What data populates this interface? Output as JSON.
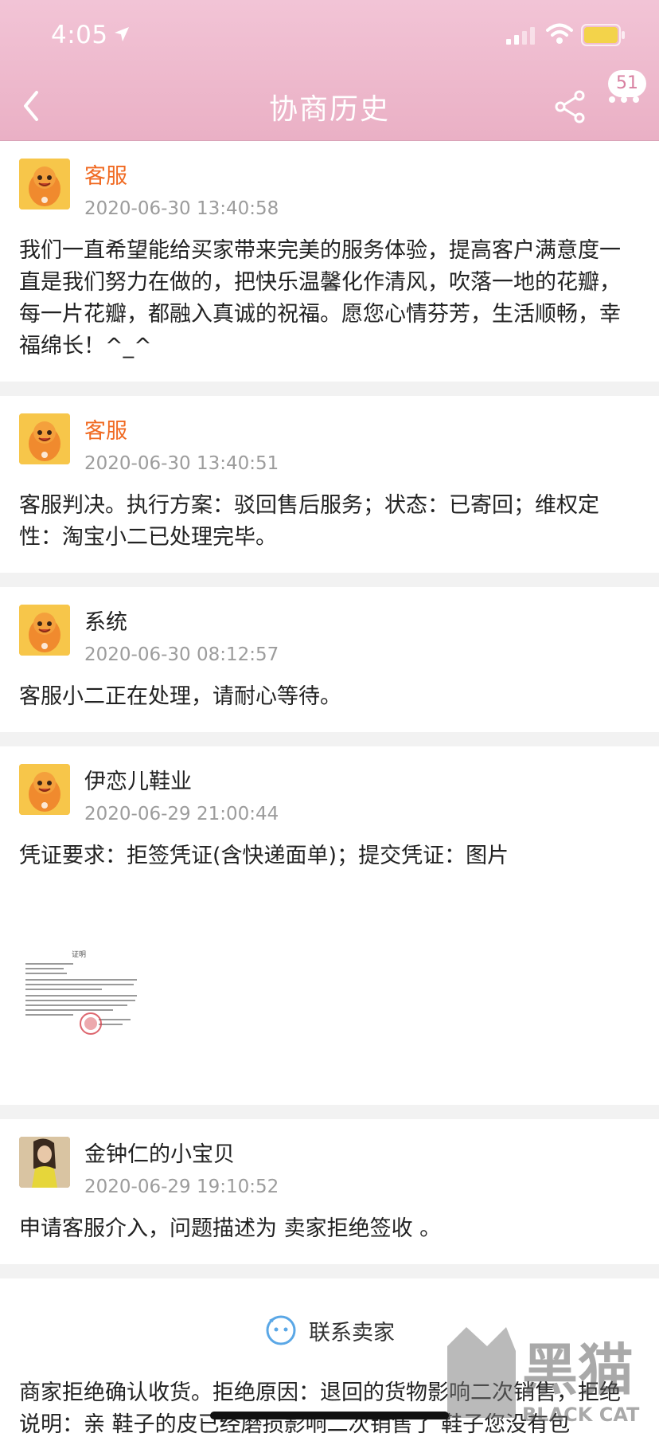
{
  "status_bar": {
    "time": "4:05",
    "icons": [
      "location-arrow-icon",
      "signal-icon",
      "wifi-icon",
      "battery-icon"
    ]
  },
  "nav": {
    "title": "协商历史",
    "badge_count": "51",
    "icons": [
      "back-icon",
      "share-icon",
      "more-icon"
    ]
  },
  "colors": {
    "header_bg": "#eab0c5",
    "customer_service_name": "#f06a22",
    "timestamp": "#9c9c9c",
    "separator": "#f2f2f2"
  },
  "records": [
    {
      "sender": "客服",
      "timestamp": "2020-06-30 13:40:58",
      "text": "我们一直希望能给买家带来完美的服务体验，提高客户满意度一直是我们努力在做的，把快乐温馨化作清风，吹落一地的花瓣，每一片花瓣，都融入真诚的祝福。愿您心情芬芳，生活顺畅，幸福绵长！^_^"
    },
    {
      "sender": "客服",
      "timestamp": "2020-06-30 13:40:51",
      "text": "客服判决。执行方案：驳回售后服务；状态：已寄回；维权定性：淘宝小二已处理完毕。"
    },
    {
      "sender": "系统",
      "timestamp": "2020-06-30 08:12:57",
      "text": "客服小二正在处理，请耐心等待。"
    },
    {
      "sender": "伊恋儿鞋业",
      "timestamp": "2020-06-29 21:00:44",
      "text": "凭证要求：拒签凭证(含快递面单)；提交凭证：图片",
      "evidence_title": "证明"
    },
    {
      "sender": "金钟仁的小宝贝",
      "timestamp": "2020-06-29 19:10:52",
      "text": "申请客服介入，问题描述为  卖家拒绝签收  。"
    }
  ],
  "contact": {
    "label": "联系卖家",
    "icon": "chat-bubble-icon"
  },
  "last_message": "商家拒绝确认收货。拒绝原因：退回的货物影响二次销售，拒绝说明：亲  鞋子的皮已经磨损影响二次销售了  鞋子您没有包",
  "watermark": {
    "text": "黑猫",
    "subtext": "BLACK CAT"
  }
}
